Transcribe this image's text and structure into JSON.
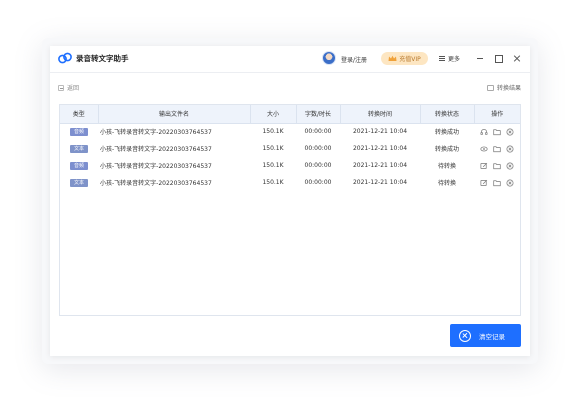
{
  "app": {
    "title": "录音转文字助手"
  },
  "header": {
    "login_label": "登录/注册",
    "vip_label": "充值VIP",
    "more_label": "更多"
  },
  "toolbar": {
    "back_label": "返回",
    "result_label": "转换结果"
  },
  "table": {
    "columns": [
      "类型",
      "输出文件名",
      "大小",
      "字数/时长",
      "转换时间",
      "转换状态",
      "操作"
    ],
    "rows": [
      {
        "type": "音频",
        "filename": "小孩-飞转录音转文字-20220303764537",
        "size": "150.1K",
        "duration": "00:00:00",
        "time": "2021-12-21 10:04",
        "status": "转换成功",
        "icons": [
          "headphone-icon",
          "folder-icon",
          "delete-icon"
        ]
      },
      {
        "type": "文本",
        "filename": "小孩-飞转录音转文字-20220303764537",
        "size": "150.1K",
        "duration": "00:00:00",
        "time": "2021-12-21 10:04",
        "status": "转换成功",
        "icons": [
          "eye-icon",
          "folder-icon",
          "delete-icon"
        ]
      },
      {
        "type": "音频",
        "filename": "小孩-飞转录音转文字-20220303764537",
        "size": "150.1K",
        "duration": "00:00:00",
        "time": "2021-12-21 10:04",
        "status": "待转换",
        "icons": [
          "edit-icon",
          "folder-icon",
          "delete-icon"
        ]
      },
      {
        "type": "文本",
        "filename": "小孩-飞转录音转文字-20220303764537",
        "size": "150.1K",
        "duration": "00:00:00",
        "time": "2021-12-21 10:04",
        "status": "待转换",
        "icons": [
          "edit-icon",
          "folder-icon",
          "delete-icon"
        ]
      }
    ]
  },
  "actions": {
    "clear_label": "清空记录"
  },
  "colors": {
    "accent": "#1e6fff",
    "vip_bg": "#fde6c2",
    "vip_text": "#b7772a",
    "badge": "#7d8fcf",
    "header_bg": "#eef3fb"
  }
}
